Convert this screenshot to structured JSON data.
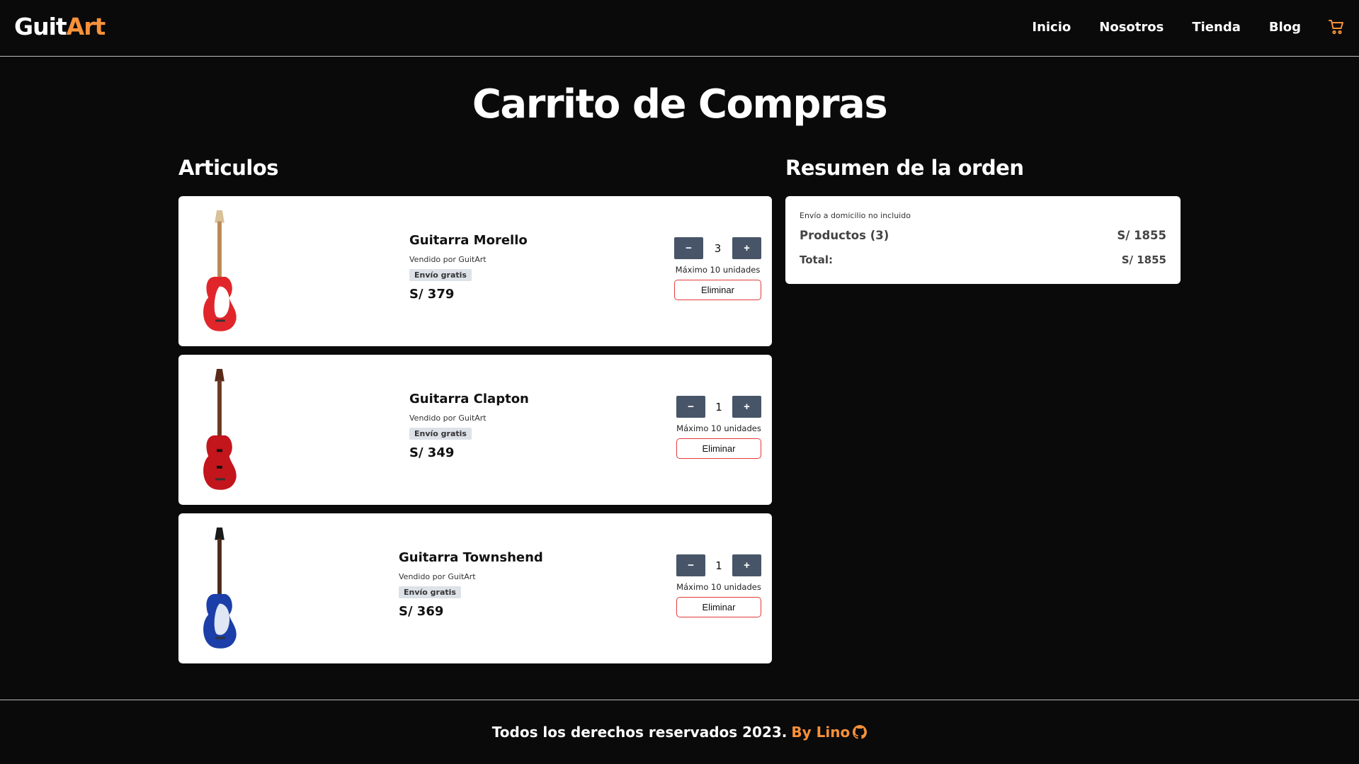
{
  "brand": {
    "part1": "Guit",
    "part2": "Art",
    "accent_color": "#f7913a"
  },
  "nav": {
    "items": [
      "Inicio",
      "Nosotros",
      "Tienda",
      "Blog"
    ],
    "cart_icon": "cart-icon"
  },
  "page_title": "Carrito de Compras",
  "articles_title": "Articulos",
  "summary_title": "Resumen de la orden",
  "cart": [
    {
      "name": "Guitarra Morello",
      "seller": "Vendido por GuitArt",
      "badge": "Envío gratis",
      "price": "S/ 379",
      "qty": "3",
      "minus": "−",
      "plus": "+",
      "max": "Máximo 10 unidades",
      "delete": "Eliminar",
      "colors": {
        "body": "#e1262b",
        "guard": "#ffffff"
      }
    },
    {
      "name": "Guitarra Clapton",
      "seller": "Vendido por GuitArt",
      "badge": "Envío gratis",
      "price": "S/ 349",
      "qty": "1",
      "minus": "−",
      "plus": "+",
      "max": "Máximo 10 unidades",
      "delete": "Eliminar",
      "colors": {
        "body": "#c3151c",
        "guard": "#8e0b10"
      }
    },
    {
      "name": "Guitarra Townshend",
      "seller": "Vendido por GuitArt",
      "badge": "Envío gratis",
      "price": "S/ 369",
      "qty": "1",
      "minus": "−",
      "plus": "+",
      "max": "Máximo 10 unidades",
      "delete": "Eliminar",
      "colors": {
        "body": "#1c3ea8",
        "guard": "#dfe6f4"
      }
    }
  ],
  "summary": {
    "shipping_note": "Envío a domicilio no incluido",
    "products_label": "Productos (3)",
    "products_value": "S/ 1855",
    "total_label": "Total:",
    "total_value": "S/ 1855"
  },
  "footer": {
    "text": "Todos los derechos reservados 2023.",
    "by": "By Lino",
    "icon": "github-icon"
  }
}
